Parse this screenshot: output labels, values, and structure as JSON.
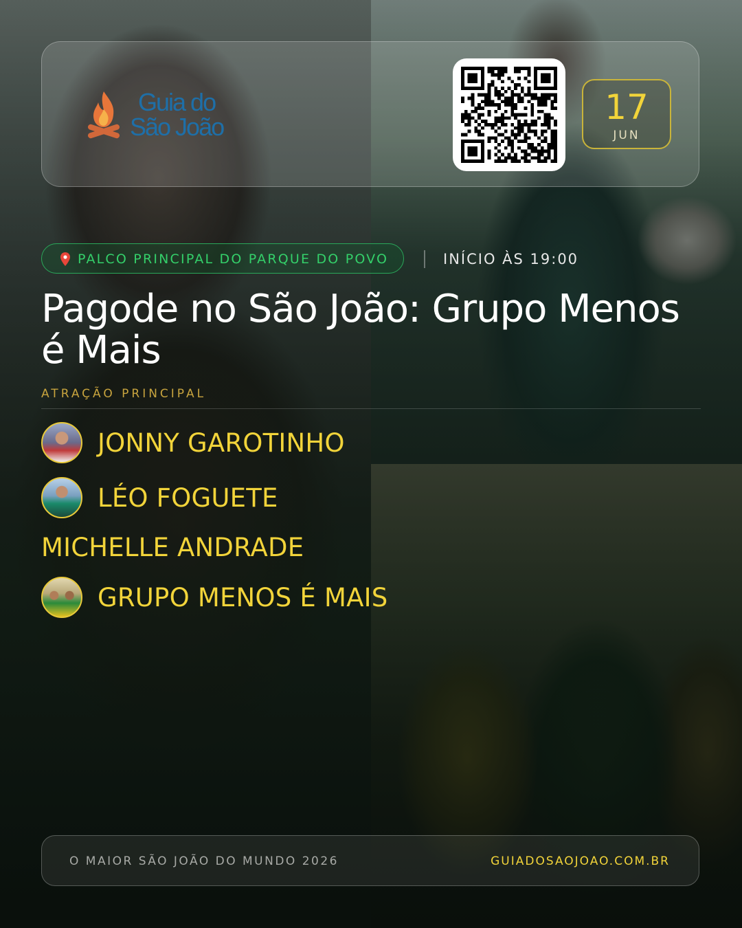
{
  "brand": {
    "logo_line1": "Guia do",
    "logo_line2": "São João"
  },
  "date": {
    "day": "17",
    "month": "JUN"
  },
  "event": {
    "venue": "PALCO PRINCIPAL DO PARQUE DO POVO",
    "start_time": "INÍCIO ÀS 19:00",
    "title": "Pagode no São João: Grupo Menos é Mais",
    "section_label": "ATRAÇÃO PRINCIPAL"
  },
  "artists": [
    {
      "name": "JONNY GAROTINHO",
      "has_avatar": true
    },
    {
      "name": "LÉO FOGUETE",
      "has_avatar": true
    },
    {
      "name": "MICHELLE ANDRADE",
      "has_avatar": false
    },
    {
      "name": "GRUPO MENOS É MAIS",
      "has_avatar": true
    }
  ],
  "footer": {
    "tagline": "O MAIOR SÃO JOÃO DO MUNDO 2026",
    "website": "GUIADOSAOJOAO.COM.BR"
  },
  "icons": {
    "logo": "campfire-icon",
    "venue": "location-pin-icon",
    "qr": "qr-code"
  },
  "colors": {
    "accent_yellow": "#f2d43a",
    "venue_green": "#34d06a",
    "logo_blue": "#1e6fa8",
    "logo_flame": "#e8763a"
  }
}
